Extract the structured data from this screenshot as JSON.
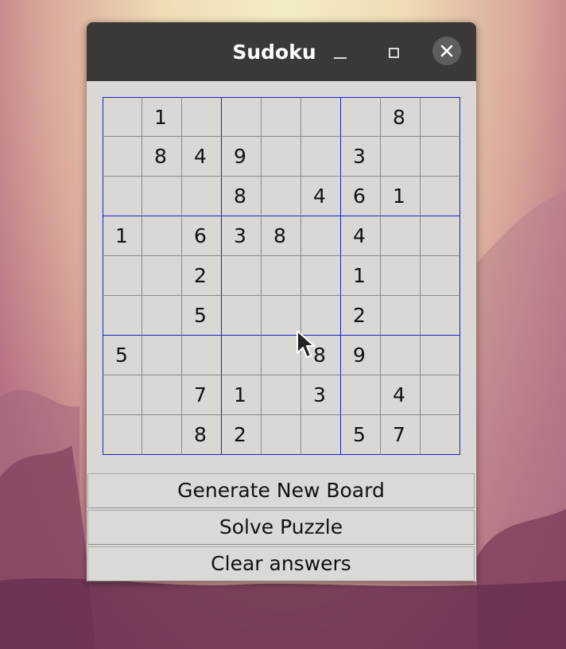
{
  "window": {
    "title": "Sudoku"
  },
  "board": [
    [
      "",
      "1",
      "",
      "",
      "",
      "",
      "",
      "8",
      ""
    ],
    [
      "",
      "8",
      "4",
      "9",
      "",
      "",
      "3",
      "",
      ""
    ],
    [
      "",
      "",
      "",
      "8",
      "",
      "4",
      "6",
      "1",
      ""
    ],
    [
      "1",
      "",
      "6",
      "3",
      "8",
      "",
      "4",
      "",
      ""
    ],
    [
      "",
      "",
      "2",
      "",
      "",
      "",
      "1",
      "",
      ""
    ],
    [
      "",
      "",
      "5",
      "",
      "",
      "",
      "2",
      "",
      ""
    ],
    [
      "5",
      "",
      "",
      "",
      "",
      "8",
      "9",
      "",
      ""
    ],
    [
      "",
      "",
      "7",
      "1",
      "",
      "3",
      "",
      "4",
      ""
    ],
    [
      "",
      "",
      "8",
      "2",
      "",
      "",
      "5",
      "7",
      ""
    ]
  ],
  "buttons": {
    "generate": "Generate New Board",
    "solve": "Solve Puzzle",
    "clear": "Clear answers"
  },
  "colors": {
    "titlebar": "#3a3938",
    "window_bg": "#d9d8d4",
    "box_border": "#1d1dd3",
    "cell_border": "#8a8a8a"
  }
}
